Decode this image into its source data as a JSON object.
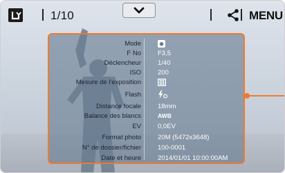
{
  "toolbar": {
    "counter": "1/10",
    "menu_label": "MENU",
    "icons": [
      "back-icon",
      "chevron-down-icon",
      "share-icon"
    ]
  },
  "info": {
    "rows": [
      {
        "label": "Mode",
        "value": "",
        "icon": "program-mode-icon"
      },
      {
        "label": "F No",
        "value": "F3,5"
      },
      {
        "label": "Déclencheur",
        "value": "1/40"
      },
      {
        "label": "ISO",
        "value": "200"
      },
      {
        "label": "Mesure de l'exposition",
        "value": "",
        "icon": "multi-metering-icon"
      },
      {
        "label": "Flash",
        "value": "",
        "icon": "flash-icon"
      },
      {
        "label": "Distance focale",
        "value": "18mm"
      },
      {
        "label": "Balance des blancs",
        "value": "AWB"
      },
      {
        "label": "EV",
        "value": "0,0EV"
      },
      {
        "label": "Format photo",
        "value": "20M (5472x3648)"
      },
      {
        "label": "N° de dossier/fichier",
        "value": "100-0001"
      },
      {
        "label": "Date et heure",
        "value": "2014/01/01 10:00:00AM"
      }
    ]
  },
  "colors": {
    "accent_orange": "#f2792b",
    "panel_fill": "#687c92"
  }
}
